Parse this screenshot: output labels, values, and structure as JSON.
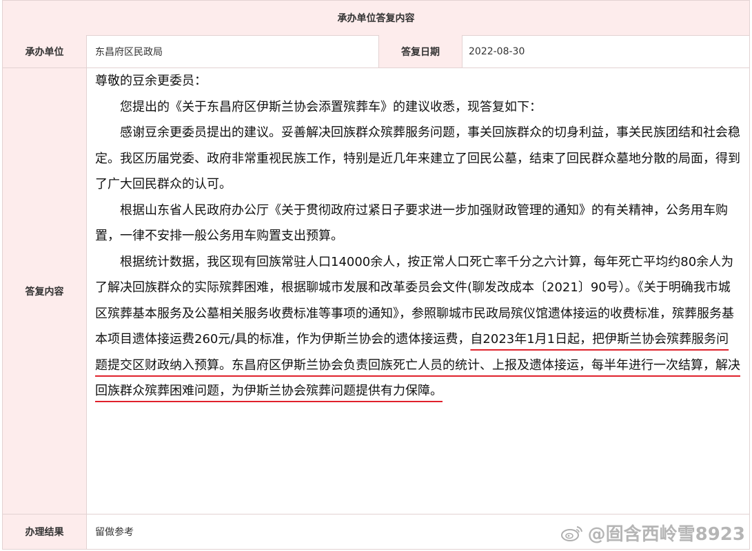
{
  "header": {
    "title": "承办单位答复内容"
  },
  "info": {
    "unit_label": "承办单位",
    "unit_value": "东昌府区民政局",
    "date_label": "答复日期",
    "date_value": "2022-08-30"
  },
  "reply": {
    "label": "答复内容",
    "greeting": "尊敬的豆余更委员：",
    "p1": "您提出的《关于东昌府区伊斯兰协会添置殡葬车》的建议收悉，现答复如下：",
    "p2": "感谢豆余更委员提出的建议。妥善解决回族群众殡葬服务问题，事关回族群众的切身利益，事关民族团结和社会稳定。我区历届党委、政府非常重视民族工作，特别是近几年来建立了回民公墓，结束了回民群众墓地分散的局面，得到了广大回民群众的认可。",
    "p3": "根据山东省人民政府办公厅《关于贯彻政府过紧日子要求进一步加强财政管理的通知》的有关精神，公务用车购置，一律不安排一般公务用车购置支出预算。",
    "p4_plain": "根据统计数据，我区现有回族常驻人口14000余人，按正常人口死亡率千分之六计算，每年死亡平均约80余人为了解决回族群众的实际殡葬困难，根据聊城市发展和改革委员会文件(聊发改成本〔2021〕90号）。《关于明确我市城区殡葬基本服务及公墓相关服务收费标准等事项的通知》，参照聊城市民政局殡仪馆遗体接运的收费标准，殡葬服务基本项目遗体接运费260元/具的标准，作为伊斯兰协会的遗体接运费，",
    "p4_underlined": "自2023年1月1日起，把伊斯兰协会殡葬服务问题提交区财政纳入预算。东昌府区伊斯兰协会负责回族死亡人员的统计、上报及遗体接运，每半年进行一次结算，解决回族群众殡葬困难问题，为伊斯兰协会殡葬问题提供有力保障。"
  },
  "result": {
    "label": "办理结果",
    "value": "留做参考"
  },
  "watermark": {
    "text": "@囼含西岭雪8923",
    "icon": "weibo-icon"
  },
  "colors": {
    "label_bg": "#fdecec",
    "border": "#e2d2d2",
    "underline": "#e0202a"
  }
}
